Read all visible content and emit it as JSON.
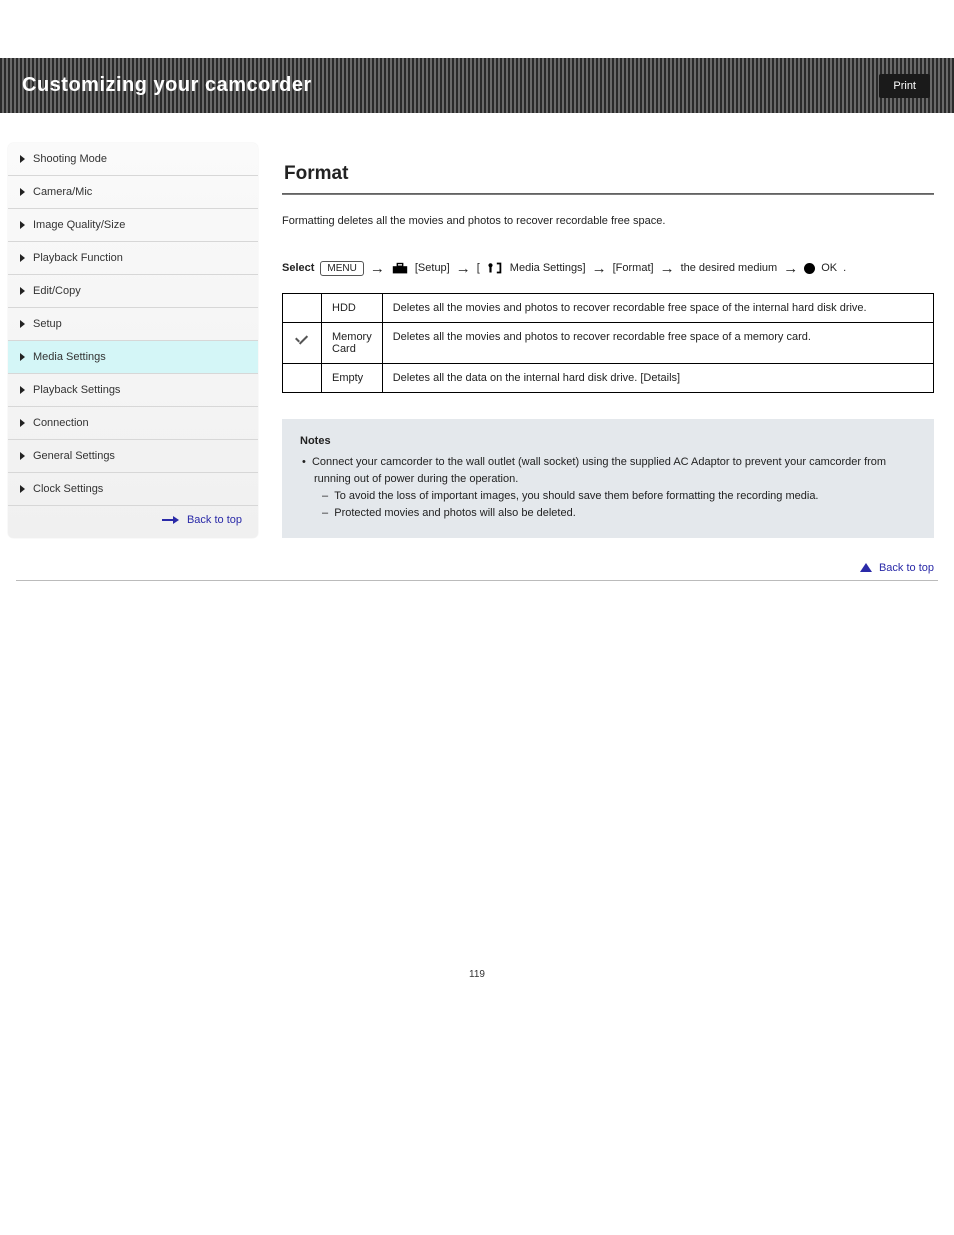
{
  "header": {
    "title": "Customizing your camcorder",
    "print_label": "Print"
  },
  "sidebar": {
    "items": [
      {
        "label": "Shooting Mode"
      },
      {
        "label": "Camera/Mic"
      },
      {
        "label": "Image Quality/Size"
      },
      {
        "label": "Playback Function"
      },
      {
        "label": "Edit/Copy"
      },
      {
        "label": "Setup"
      },
      {
        "label": "Media Settings"
      },
      {
        "label": "Playback Settings"
      },
      {
        "label": "Connection"
      },
      {
        "label": "General Settings"
      },
      {
        "label": "Clock Settings"
      }
    ],
    "active_index": 6,
    "back_to_top": "Back to top"
  },
  "content": {
    "title": "Format",
    "lead": "Formatting deletes all the movies and photos to recover recordable free space.",
    "path": {
      "step0": "Select",
      "menu": "MENU",
      "arrow": "→",
      "setup_label": "[Setup]",
      "media_label": "[",
      "media_label2": "Media Settings]",
      "format_label": "[Format]",
      "desired_label": "the desired medium",
      "ok_label": "OK",
      "period": "."
    },
    "table": [
      {
        "icon": "",
        "label": "HDD",
        "desc": "Deletes all the movies and photos to recover recordable free space of the internal hard disk drive."
      },
      {
        "icon": "check",
        "label": "Memory Card",
        "desc": "Deletes all the movies and photos to recover recordable free space of a memory card."
      },
      {
        "icon": "",
        "label": "Empty",
        "desc": "Deletes all the data on the internal hard disk drive. [Details]"
      }
    ],
    "notes": {
      "heading": "Notes",
      "bullet": "Connect your camcorder to the wall outlet (wall socket) using the supplied AC Adaptor to prevent your camcorder from running out of power during the operation.",
      "sub1": "To avoid the loss of important images, you should save them before formatting the recording media.",
      "sub2": "Protected movies and photos will also be deleted."
    }
  },
  "footer": {
    "back_to_top": "Back to top",
    "page_number": "119"
  }
}
